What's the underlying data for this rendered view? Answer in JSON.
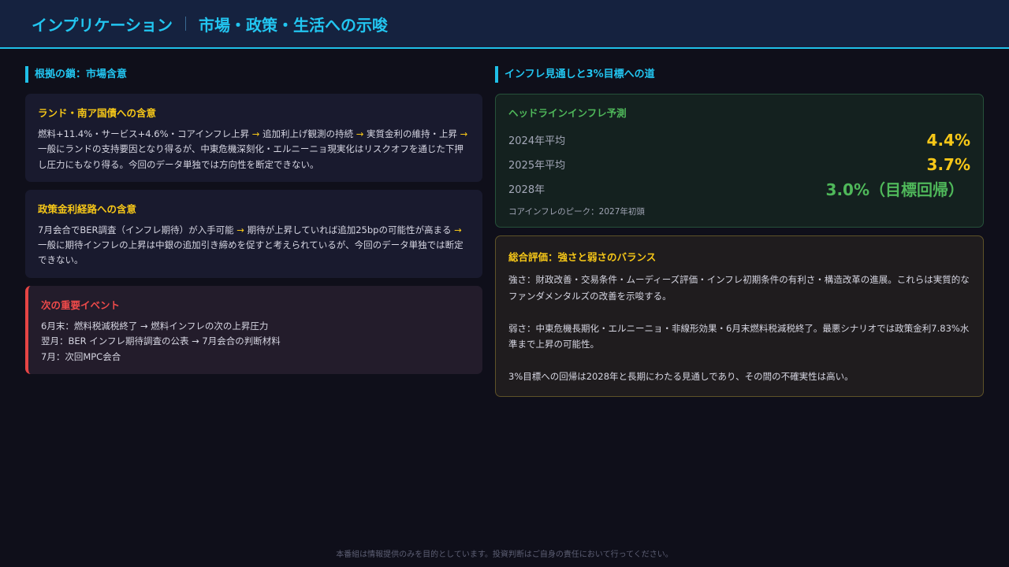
{
  "header": {
    "title_left": "インプリケーション",
    "title_right": "市場・政策・生活への示唆"
  },
  "left": {
    "section_title": "根拠の鎖：市場含意",
    "card1": {
      "title": "ランド・南ア国債への含意",
      "t1": "燃料+11.4%・サービス+4.6%・コアインフレ上昇 ",
      "a1": "→",
      "t2": " 追加利上げ観測の持続 ",
      "a2": "→",
      "t3": " 実質金利の維持・上昇 ",
      "a3": "→",
      "t4": " 一般にランドの支持要因となり得るが、中東危機深刻化・エルニーニョ現実化はリスクオフを通じた下押し圧力にもなり得る。今回のデータ単独では方向性を断定できない。"
    },
    "card2": {
      "title": "政策金利経路への含意",
      "t1": "7月会合でBER調査（インフレ期待）が入手可能 ",
      "a1": "→",
      "t2": " 期待が上昇していれば追加25bpの可能性が高まる ",
      "a2": "→",
      "t3": " 一般に期待インフレの上昇は中銀の追加引き締めを促すと考えられているが、今回のデータ単独では断定できない。"
    },
    "events": {
      "title": "次の重要イベント",
      "lines": [
        "6月末：燃料税減税終了 → 燃料インフレの次の上昇圧力",
        "翌月：BER インフレ期待調査の公表 → 7月会合の判断材料",
        "7月：次回MPC会合"
      ]
    }
  },
  "right": {
    "section_title": "インフレ見通しと3%目標への道",
    "forecast": {
      "title": "ヘッドラインインフレ予測",
      "rows": [
        {
          "label": "2024年平均",
          "value": "4.4%"
        },
        {
          "label": "2025年平均",
          "value": "3.7%"
        },
        {
          "label": "2028年",
          "value": "3.0%（目標回帰）"
        }
      ],
      "note": "コアインフレのピーク：2027年初頭"
    },
    "summary": {
      "title": "総合評価：強さと弱さのバランス",
      "p1": "強さ：財政改善・交易条件・ムーディーズ評価・インフレ初期条件の有利さ・構造改革の進展。これらは実質的なファンダメンタルズの改善を示唆する。",
      "p2": "弱さ：中東危機長期化・エルニーニョ・非線形効果・6月末燃料税減税終了。最悪シナリオでは政策金利7.83%水準まで上昇の可能性。",
      "p3": "3%目標への回帰は2028年と長期にわたる見通しであり、その間の不確実性は高い。"
    }
  },
  "footer": {
    "disclaimer": "本番組は情報提供のみを目的としています。投資判断はご自身の責任において行ってください。"
  },
  "colors": {
    "accent_cyan": "#22c5f0",
    "accent_yellow": "#f6c718",
    "accent_green": "#4fb85a",
    "accent_red": "#ee4a4a"
  }
}
